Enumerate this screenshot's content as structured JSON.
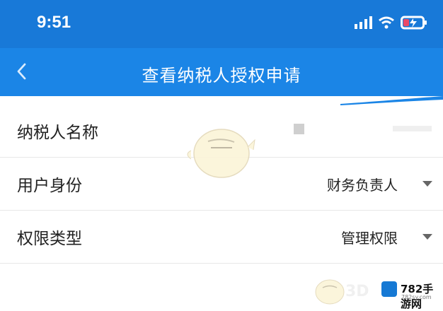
{
  "status": {
    "time": "9:51"
  },
  "header": {
    "title": "查看纳税人授权申请",
    "back_icon": "chevron-left-icon"
  },
  "form": {
    "rows": [
      {
        "label": "纳税人名称",
        "value": ""
      },
      {
        "label": "用户身份",
        "value": "财务负责人"
      },
      {
        "label": "权限类型",
        "value": "管理权限"
      }
    ]
  },
  "watermark": {
    "logo_text": "782手游网",
    "logo_sub": "782sy.com",
    "faint_text": "3D"
  },
  "colors": {
    "statusbar": "#1879d8",
    "navbar": "#1b85e6",
    "text": "#222222",
    "divider": "#e7e7e7"
  }
}
